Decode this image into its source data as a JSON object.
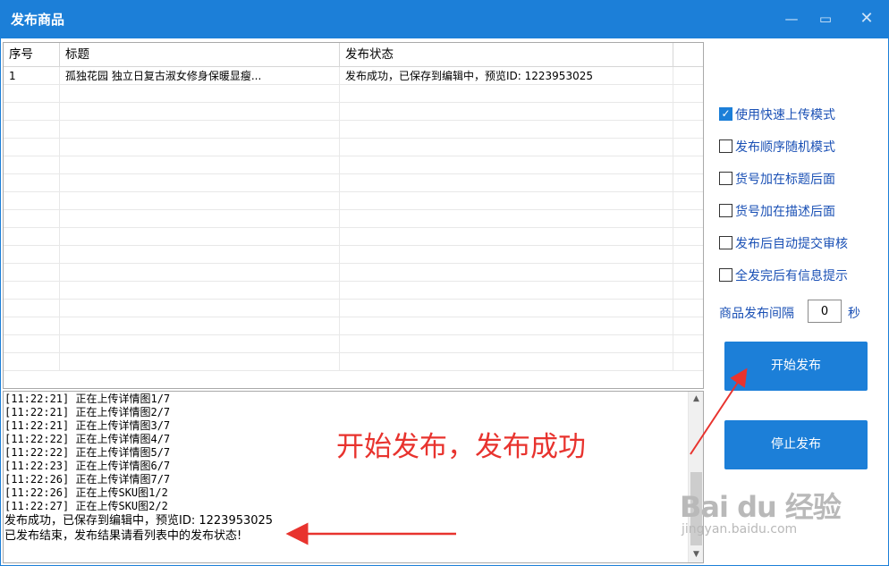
{
  "window": {
    "title": "发布商品",
    "min_icon": "minimize-icon",
    "max_icon": "maximize-icon",
    "close_icon": "close-icon"
  },
  "table": {
    "columns": [
      "序号",
      "标题",
      "发布状态",
      ""
    ],
    "rows": [
      [
        "1",
        "孤独花园 独立日复古淑女修身保暖显瘦...",
        "发布成功，已保存到编辑中，预览ID: 1223953025",
        ""
      ]
    ],
    "empty_row_count": 16
  },
  "log": {
    "lines": [
      "[11:22:21] 正在上传详情图1/7",
      "[11:22:21] 正在上传详情图2/7",
      "[11:22:21] 正在上传详情图3/7",
      "[11:22:22] 正在上传详情图4/7",
      "[11:22:22] 正在上传详情图5/7",
      "[11:22:23] 正在上传详情图6/7",
      "[11:22:26] 正在上传详情图7/7",
      "[11:22:26] 正在上传SKU图1/2",
      "[11:22:27] 正在上传SKU图2/2"
    ],
    "result_lines": [
      "发布成功，已保存到编辑中，预览ID: 1223953025",
      "已发布结束，发布结果请看列表中的发布状态!"
    ]
  },
  "options": [
    {
      "label": "使用快速上传模式",
      "checked": true
    },
    {
      "label": "发布顺序随机模式",
      "checked": false
    },
    {
      "label": "货号加在标题后面",
      "checked": false
    },
    {
      "label": "货号加在描述后面",
      "checked": false
    },
    {
      "label": "发布后自动提交审核",
      "checked": false
    },
    {
      "label": "全发完后有信息提示",
      "checked": false
    }
  ],
  "interval": {
    "label": "商品发布间隔",
    "value": "0",
    "unit": "秒"
  },
  "buttons": {
    "start": "开始发布",
    "stop": "停止发布"
  },
  "annotation": {
    "text": "开始发布，发布成功",
    "color": "#e8332e"
  },
  "watermark": {
    "logo": "Bai du 经验",
    "url": "jingyan.baidu.com"
  },
  "colors": {
    "accent": "#1c7fd8",
    "option_text": "#1a50b5"
  }
}
